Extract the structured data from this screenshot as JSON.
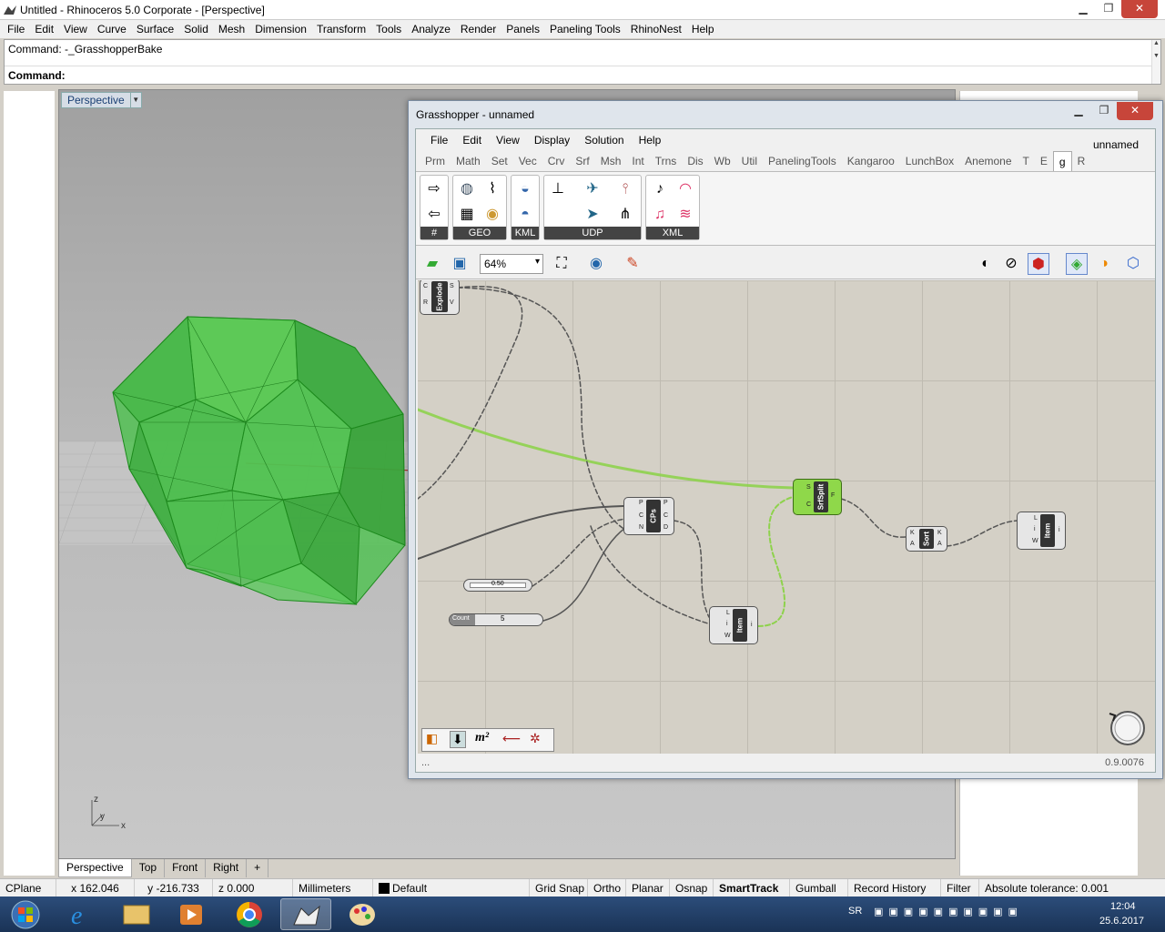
{
  "window": {
    "title": "Untitled - Rhinoceros  5.0 Corporate - [Perspective]"
  },
  "menu": [
    "File",
    "Edit",
    "View",
    "Curve",
    "Surface",
    "Solid",
    "Mesh",
    "Dimension",
    "Transform",
    "Tools",
    "Analyze",
    "Render",
    "Panels",
    "Paneling Tools",
    "RhinoNest",
    "Help"
  ],
  "command": {
    "history": "Command: -_GrasshopperBake",
    "prompt": "Command:"
  },
  "viewport": {
    "name": "Perspective",
    "axis": {
      "z": "z",
      "y": "y",
      "x": "x"
    }
  },
  "viewport_tabs": [
    "Perspective",
    "Top",
    "Front",
    "Right",
    "+"
  ],
  "status_bar": {
    "cplane": "CPlane",
    "x": "x 162.046",
    "y": "y -216.733",
    "z": "z 0.000",
    "units": "Millimeters",
    "layer": "Default",
    "toggles": [
      "Grid Snap",
      "Ortho",
      "Planar",
      "Osnap",
      "SmartTrack",
      "Gumball",
      "Record History",
      "Filter"
    ],
    "tolerance": "Absolute tolerance: 0.001"
  },
  "grasshopper": {
    "title": "Grasshopper - unnamed",
    "doc_name": "unnamed",
    "menu": [
      "File",
      "Edit",
      "View",
      "Display",
      "Solution",
      "Help"
    ],
    "tabs": [
      "Prm",
      "Math",
      "Set",
      "Vec",
      "Crv",
      "Srf",
      "Msh",
      "Int",
      "Trns",
      "Dis",
      "Wb",
      "Util",
      "PanelingTools",
      "Kangaroo",
      "LunchBox",
      "Anemone",
      "T",
      "E",
      "g",
      "R"
    ],
    "active_tab": "g",
    "ribbon_groups": [
      "#",
      "GEO",
      "KML",
      "UDP",
      "XML"
    ],
    "zoom": "64%",
    "version": "0.9.0076",
    "status_left": "...",
    "components": {
      "explode": {
        "label": "Explode",
        "inputs": [
          "C",
          "R"
        ],
        "outputs": [
          "S",
          "V"
        ]
      },
      "cps": {
        "label": "CPs",
        "inputs": [
          "P",
          "C",
          "N"
        ],
        "outputs": [
          "P",
          "C",
          "D"
        ]
      },
      "srfsplit": {
        "label": "SrfSplit",
        "inputs": [
          "S",
          "C"
        ],
        "outputs": [
          "F"
        ]
      },
      "sort": {
        "label": "Sort",
        "inputs": [
          "K",
          "A"
        ],
        "outputs": [
          "K",
          "A"
        ]
      },
      "item1": {
        "label": "Item",
        "inputs": [
          "L",
          "i",
          "W"
        ],
        "outputs": [
          "i"
        ]
      },
      "item2": {
        "label": "Item",
        "inputs": [
          "L",
          "i",
          "W"
        ],
        "outputs": [
          "i"
        ]
      }
    },
    "slider_value": "0.50",
    "count": {
      "label": "Count",
      "value": "5"
    }
  },
  "taskbar": {
    "lang": "SR",
    "time": "12:04",
    "date": "25.6.2017"
  }
}
